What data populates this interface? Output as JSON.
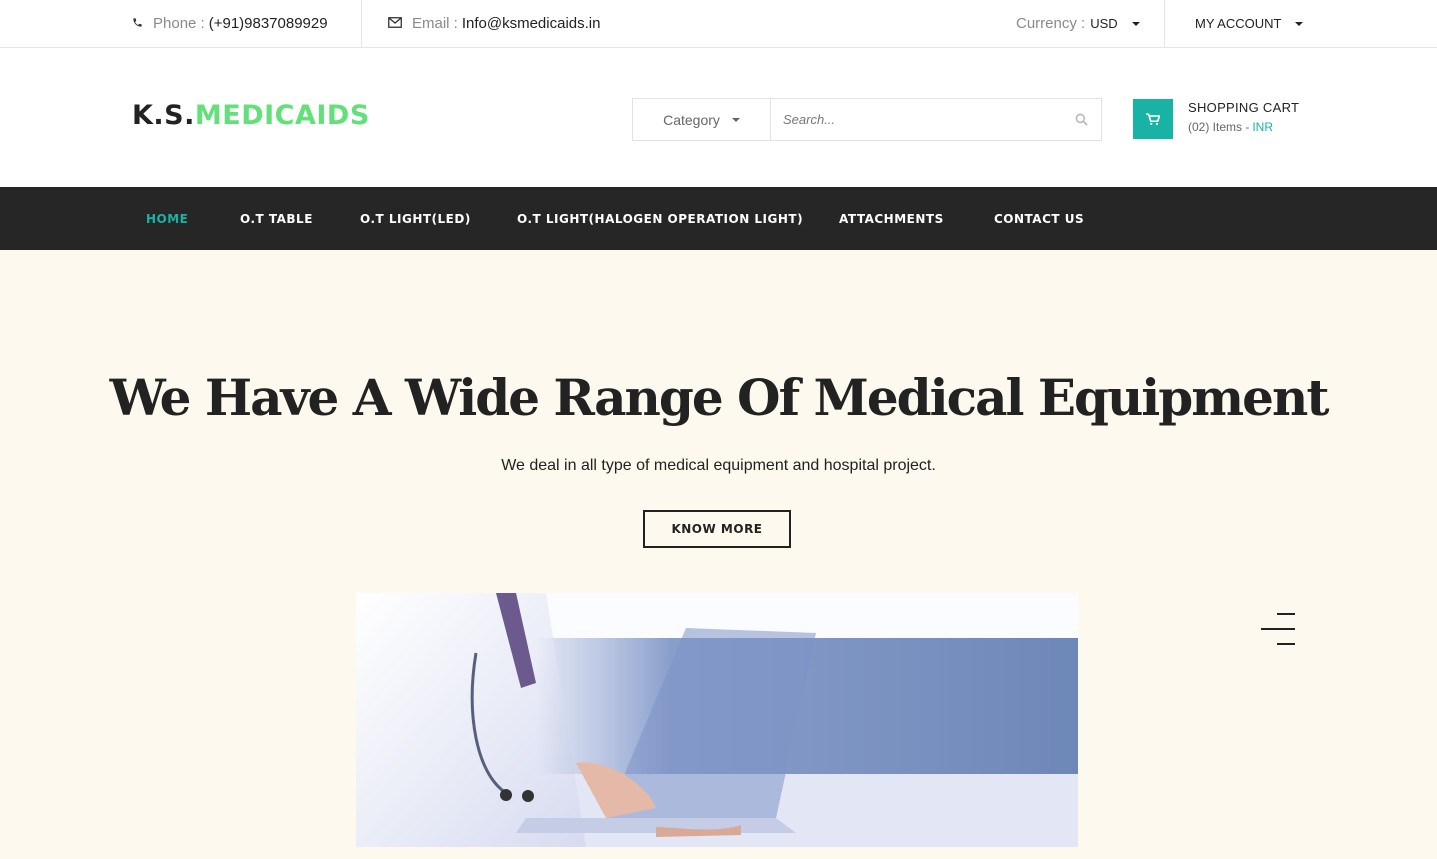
{
  "topbar": {
    "phone_label": "Phone :",
    "phone_value": "(+91)9837089929",
    "email_label": "Email :",
    "email_value": "Info@ksmedicaids.in",
    "currency_label": "Currency :",
    "currency_value": "USD",
    "account_label": "MY ACCOUNT"
  },
  "header": {
    "logo_part1": "K.S.",
    "logo_part2": "MEDICAIDS",
    "search_category": "Category",
    "search_placeholder": "Search...",
    "cart_title": "SHOPPING CART",
    "cart_items": "(02) Items -",
    "cart_currency": "INR"
  },
  "nav": {
    "items": [
      {
        "label": "HOME",
        "active": true
      },
      {
        "label": "O.T TABLE"
      },
      {
        "label": "O.T LIGHT(LED)"
      },
      {
        "label": "O.T LIGHT(HALOGEN OPERATION LIGHT)"
      },
      {
        "label": "ATTACHMENTS"
      },
      {
        "label": "CONTACT US"
      }
    ]
  },
  "hero": {
    "title": "We Have A Wide Range Of Medical Equipment",
    "subtitle": "We deal in all type of medical equipment and hospital project.",
    "button_label": "KNOW MORE"
  },
  "colors": {
    "accent": "#19b3a6",
    "logo_green": "#63e07a",
    "nav_bg": "#262626",
    "hero_bg": "#fdf9ef"
  },
  "icons": [
    "phone-icon",
    "envelope-icon",
    "search-icon",
    "shopping-cart-icon",
    "hamburger-menu-icon"
  ]
}
